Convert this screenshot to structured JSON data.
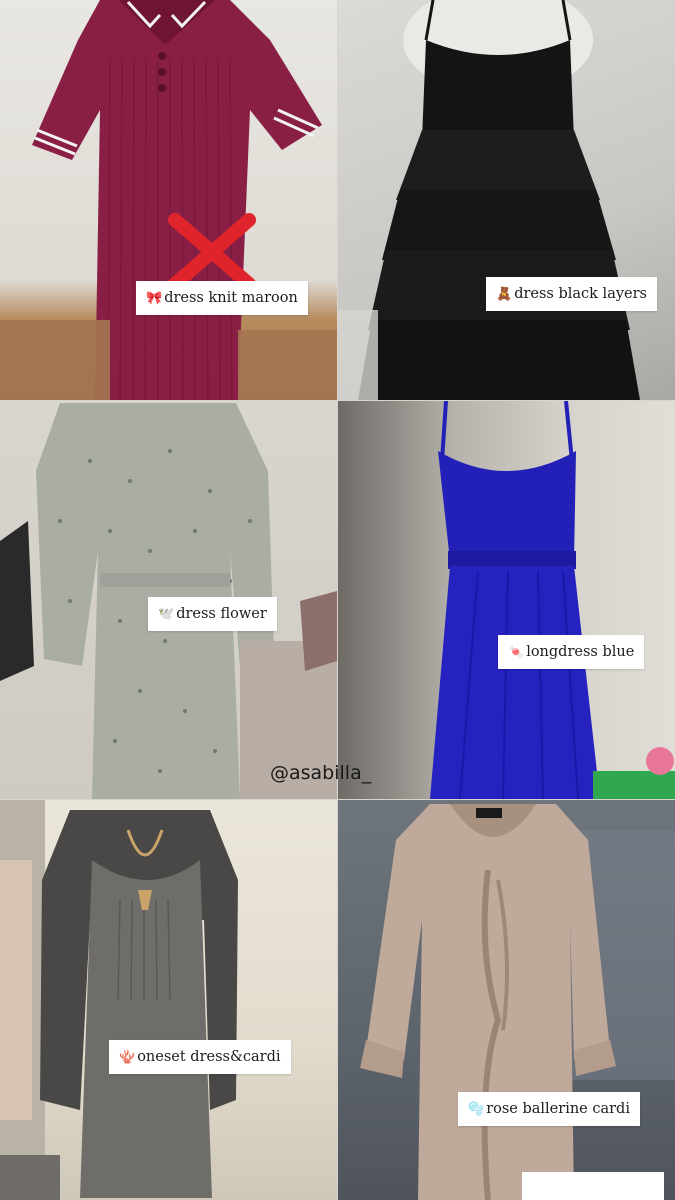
{
  "tiles": [
    {
      "name": "maroon-knit-dress",
      "label": "dress knit maroon",
      "emoji": "🎀",
      "crossed_out": true
    },
    {
      "name": "black-layered-dress",
      "label": "dress black layers",
      "emoji": "🧸"
    },
    {
      "name": "flower-dress",
      "label": "dress flower",
      "emoji": "🕊️"
    },
    {
      "name": "blue-long-dress",
      "label": "longdress blue",
      "emoji": "🍬"
    },
    {
      "name": "oneset-dress-cardi",
      "label": "oneset dress&cardi",
      "emoji": "🪸"
    },
    {
      "name": "rose-ballerine-cardi",
      "label": "rose ballerine cardi",
      "emoji": "🫧"
    }
  ],
  "watermark": "@asabilla_",
  "colors": {
    "maroon": "#8a1f45",
    "black": "#141414",
    "sage": "#a9ada4",
    "royal_blue": "#2320b8",
    "charcoal": "#4e4c4a",
    "rose_beige": "#bfa99a",
    "cross_red": "#e0242c"
  }
}
